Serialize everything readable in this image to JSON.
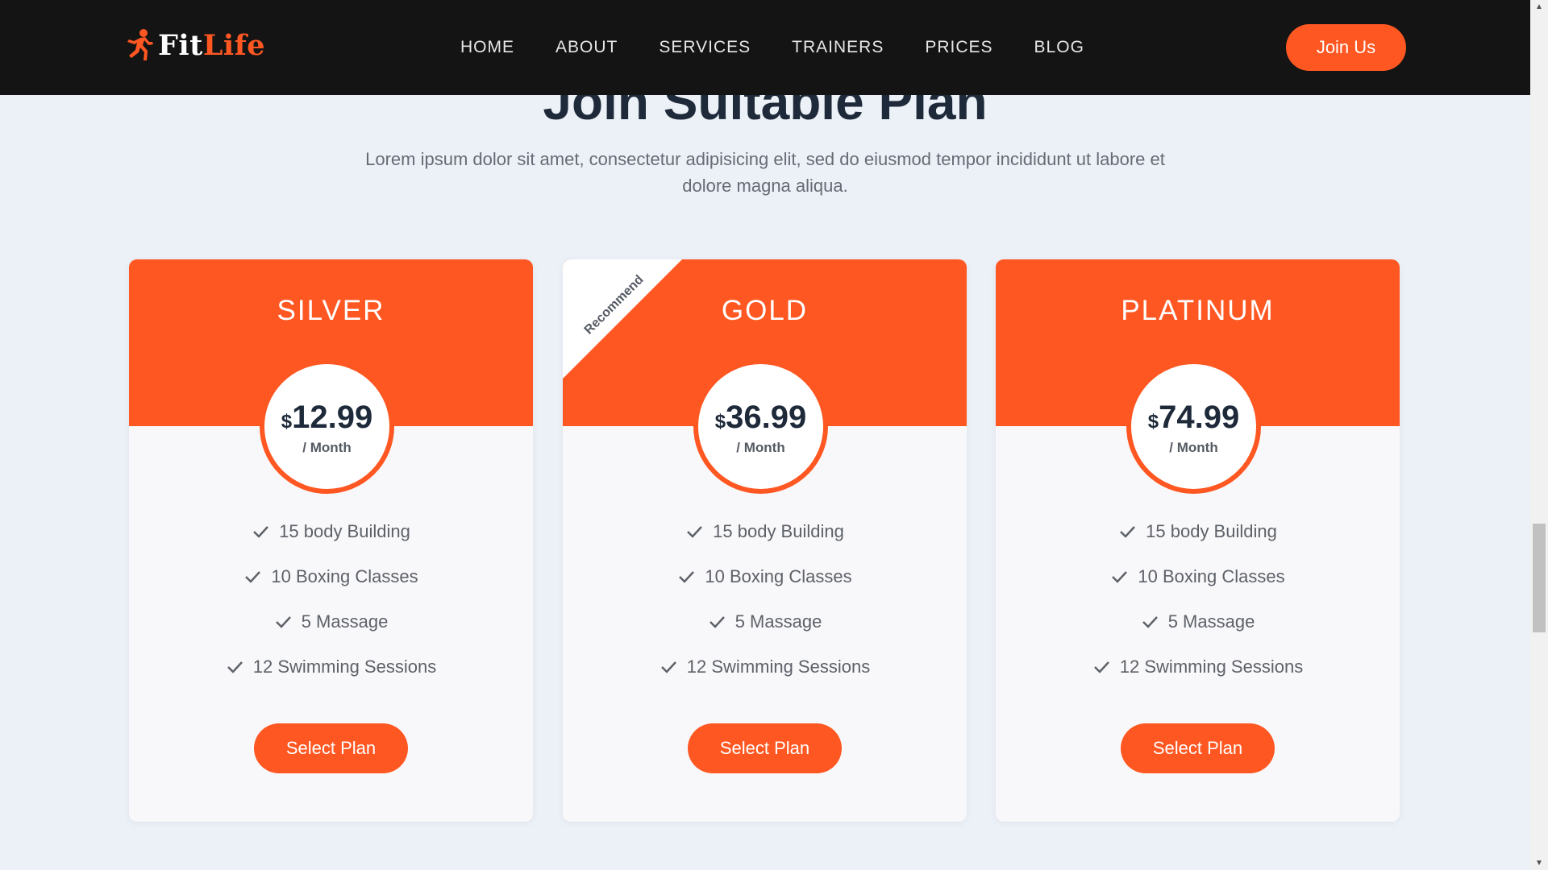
{
  "brand": {
    "name_part1": "Fit",
    "name_part2": "Life",
    "accent_color": "#ff5722",
    "logo_icon": "running-man-icon"
  },
  "nav": {
    "items": [
      "HOME",
      "ABOUT",
      "SERVICES",
      "TRAINERS",
      "PRICES",
      "BLOG"
    ],
    "join_label": "Join Us"
  },
  "section": {
    "title": "Join Suitable Plan",
    "subtitle": "Lorem ipsum dolor sit amet, consectetur adipisicing elit, sed do eiusmod tempor incididunt ut labore et dolore magna aliqua."
  },
  "plans": [
    {
      "name": "SILVER",
      "currency": "$",
      "price": "12.99",
      "period": "/ Month",
      "features": [
        "15 body Building",
        "10 Boxing Classes",
        "5 Massage",
        "12 Swimming Sessions"
      ],
      "button": "Select Plan"
    },
    {
      "name": "GOLD",
      "ribbon": "Recommend",
      "currency": "$",
      "price": "36.99",
      "period": "/ Month",
      "features": [
        "15 body Building",
        "10 Boxing Classes",
        "5 Massage",
        "12 Swimming Sessions"
      ],
      "button": "Select Plan"
    },
    {
      "name": "PLATINUM",
      "currency": "$",
      "price": "74.99",
      "period": "/ Month",
      "features": [
        "15 body Building",
        "10 Boxing Classes",
        "5 Massage",
        "12 Swimming Sessions"
      ],
      "button": "Select Plan"
    }
  ],
  "icons": {
    "feature_icon": "check-icon",
    "scroll_up": "scroll-up-arrow-icon",
    "scroll_down": "scroll-down-arrow-icon"
  }
}
